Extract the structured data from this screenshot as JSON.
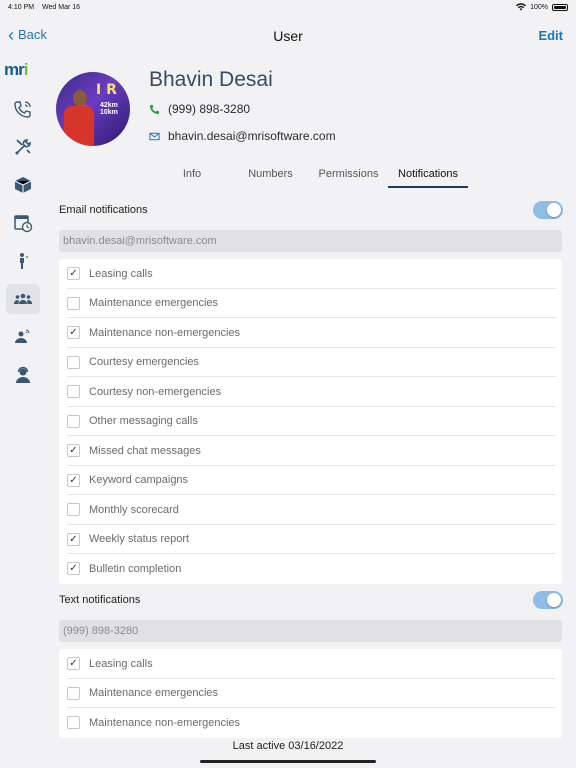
{
  "status_bar": {
    "time": "4:10 PM",
    "date": "Wed Mar 16",
    "battery": "100%"
  },
  "nav": {
    "back_label": "Back",
    "title": "User",
    "edit_label": "Edit"
  },
  "sidebar": {
    "logo": "mri",
    "items": [
      {
        "icon": "phone-wave-icon"
      },
      {
        "icon": "tools-icon"
      },
      {
        "icon": "package-icon"
      },
      {
        "icon": "calendar-clock-icon"
      },
      {
        "icon": "person-walk-icon"
      },
      {
        "icon": "people-group-icon",
        "active": true
      },
      {
        "icon": "person-broadcast-icon"
      },
      {
        "icon": "support-agent-icon"
      }
    ]
  },
  "profile": {
    "name": "Bhavin Desai",
    "phone": "(999) 898-3280",
    "email": "bhavin.desai@mrisoftware.com"
  },
  "tabs": [
    {
      "label": "Info"
    },
    {
      "label": "Numbers"
    },
    {
      "label": "Permissions"
    },
    {
      "label": "Notifications",
      "active": true
    }
  ],
  "email_notifications": {
    "label": "Email notifications",
    "enabled": true,
    "address": "bhavin.desai@mrisoftware.com",
    "items": [
      {
        "label": "Leasing calls",
        "checked": true
      },
      {
        "label": "Maintenance emergencies",
        "checked": false
      },
      {
        "label": "Maintenance non-emergencies",
        "checked": true
      },
      {
        "label": "Courtesy emergencies",
        "checked": false
      },
      {
        "label": "Courtesy non-emergencies",
        "checked": false
      },
      {
        "label": "Other messaging calls",
        "checked": false
      },
      {
        "label": "Missed chat messages",
        "checked": true
      },
      {
        "label": "Keyword campaigns",
        "checked": true
      },
      {
        "label": "Monthly scorecard",
        "checked": false
      },
      {
        "label": "Weekly status report",
        "checked": true
      },
      {
        "label": "Bulletin completion",
        "checked": true
      }
    ]
  },
  "text_notifications": {
    "label": "Text notifications",
    "enabled": true,
    "number": "(999) 898-3280",
    "items": [
      {
        "label": "Leasing calls",
        "checked": true
      },
      {
        "label": "Maintenance emergencies",
        "checked": false
      },
      {
        "label": "Maintenance non-emergencies",
        "checked": false
      }
    ]
  },
  "footer": {
    "last_active": "Last active 03/16/2022"
  },
  "colors": {
    "accent": "#1a76b8",
    "tab_underline": "#1d3a63",
    "toggle_on": "#8fbde6",
    "name_color": "#3b4a5c"
  }
}
